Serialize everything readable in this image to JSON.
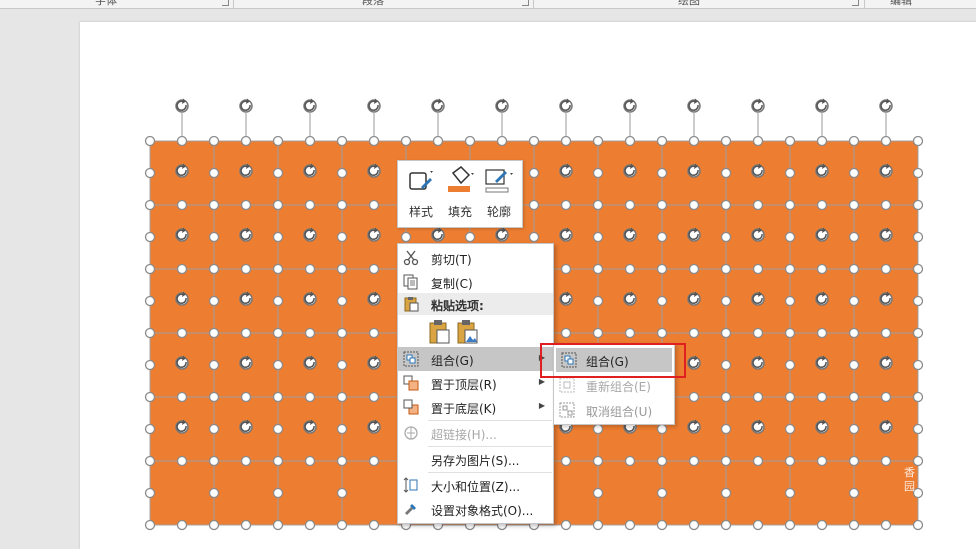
{
  "ribbon": {
    "groups": [
      "字体",
      "段落",
      "绘图",
      "编辑"
    ]
  },
  "colors": {
    "shape_fill": "#ed7d31",
    "handle_stroke": "#8a8a8a",
    "highlight": "#c6c6c6",
    "callout": "#e02020"
  },
  "grid": {
    "columns": 12,
    "rows": 6
  },
  "mini_toolbar": {
    "style": "样式",
    "fill": "填充",
    "outline": "轮廓"
  },
  "context_menu": {
    "cut": "剪切(T)",
    "copy": "复制(C)",
    "paste_options": "粘贴选项:",
    "group": "组合(G)",
    "bring_to_front": "置于顶层(R)",
    "send_to_back": "置于底层(K)",
    "hyperlink": "超链接(H)...",
    "save_as_picture": "另存为图片(S)...",
    "size_position": "大小和位置(Z)...",
    "format_object": "设置对象格式(O)..."
  },
  "submenu": {
    "group": "组合(G)",
    "regroup": "重新组合(E)",
    "ungroup": "取消组合(U)"
  },
  "watermark": "香\n园"
}
